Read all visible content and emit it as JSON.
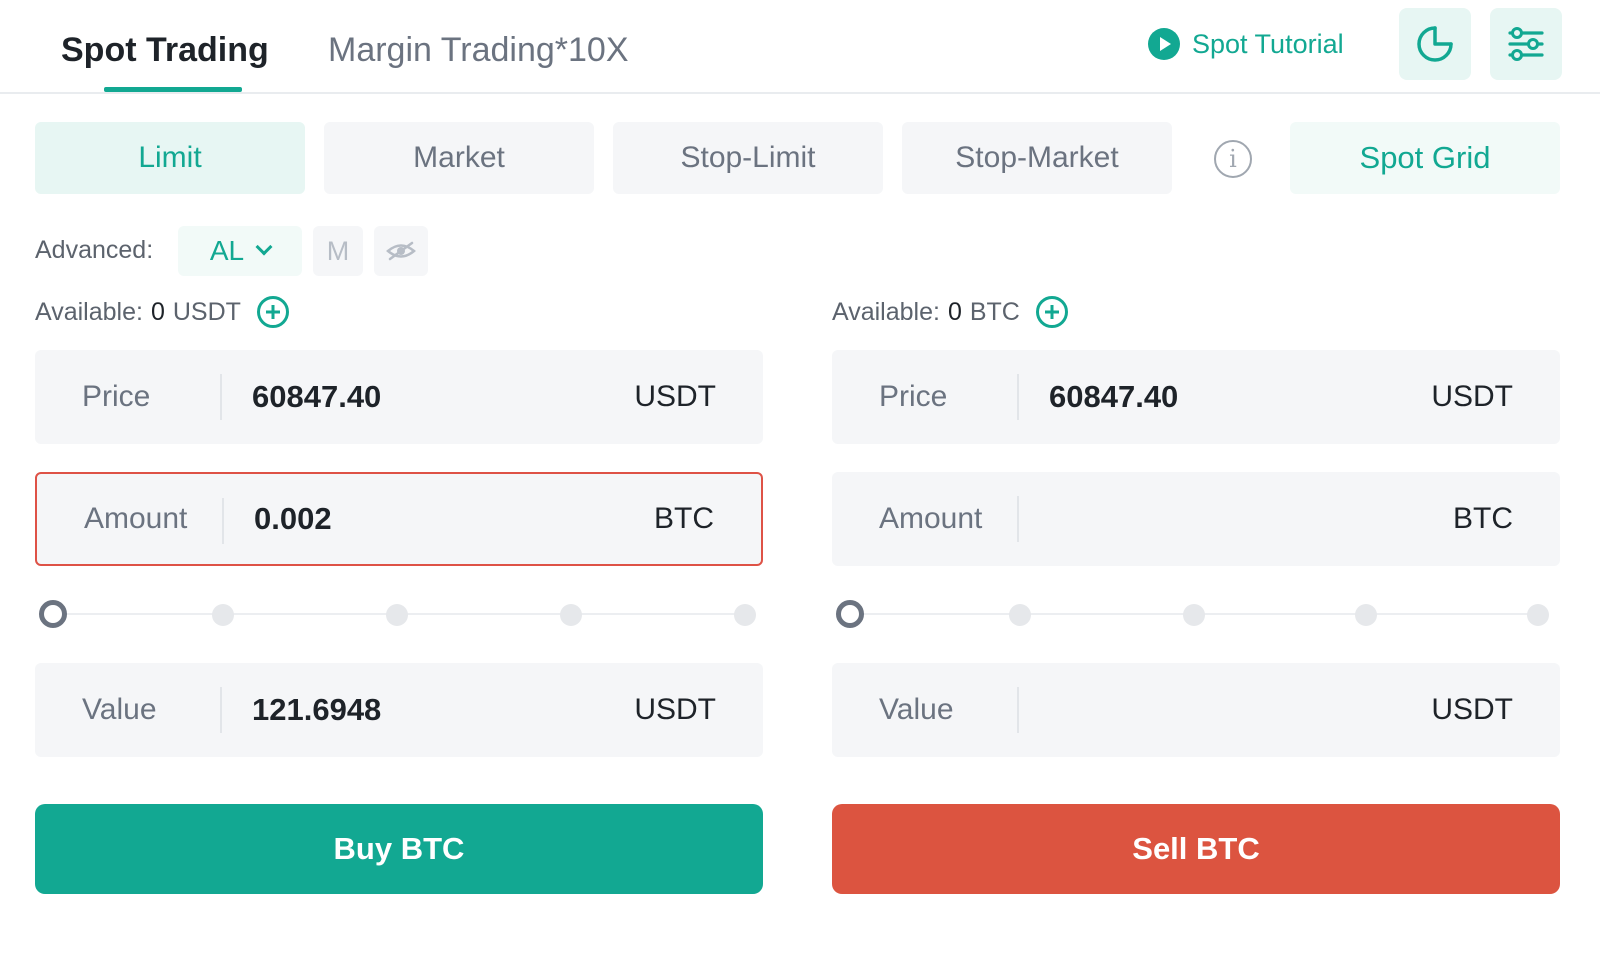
{
  "header": {
    "tabs": [
      {
        "label": "Spot Trading",
        "active": true
      },
      {
        "label": "Margin Trading*10X",
        "active": false
      }
    ],
    "tutorial_label": "Spot Tutorial",
    "icons": [
      "play-icon",
      "pie-chart-icon",
      "settings-sliders-icon"
    ]
  },
  "order_types": {
    "items": [
      {
        "label": "Limit",
        "active": true
      },
      {
        "label": "Market",
        "active": false
      },
      {
        "label": "Stop-Limit",
        "active": false
      },
      {
        "label": "Stop-Market",
        "active": false
      }
    ],
    "info_icon_glyph": "i",
    "spot_grid_label": "Spot Grid"
  },
  "advanced": {
    "label": "Advanced:",
    "al_value": "AL",
    "m_label": "M"
  },
  "buy": {
    "available_label": "Available:",
    "available_value": "0",
    "available_unit": "USDT",
    "price": {
      "label": "Price",
      "value": "60847.40",
      "unit": "USDT"
    },
    "amount": {
      "label": "Amount",
      "value": "0.002",
      "unit": "BTC"
    },
    "slider_percent": 0,
    "total": {
      "label": "Value",
      "value": "121.6948",
      "unit": "USDT"
    },
    "button_label": "Buy BTC"
  },
  "sell": {
    "available_label": "Available:",
    "available_value": "0",
    "available_unit": "BTC",
    "price": {
      "label": "Price",
      "value": "60847.40",
      "unit": "USDT"
    },
    "amount": {
      "label": "Amount",
      "value": "",
      "unit": "BTC"
    },
    "slider_percent": 0,
    "total": {
      "label": "Value",
      "value": "",
      "unit": "USDT"
    },
    "button_label": "Sell BTC"
  },
  "colors": {
    "accent": "#12a892",
    "sell": "#dc5440",
    "error_border": "#de5246"
  }
}
